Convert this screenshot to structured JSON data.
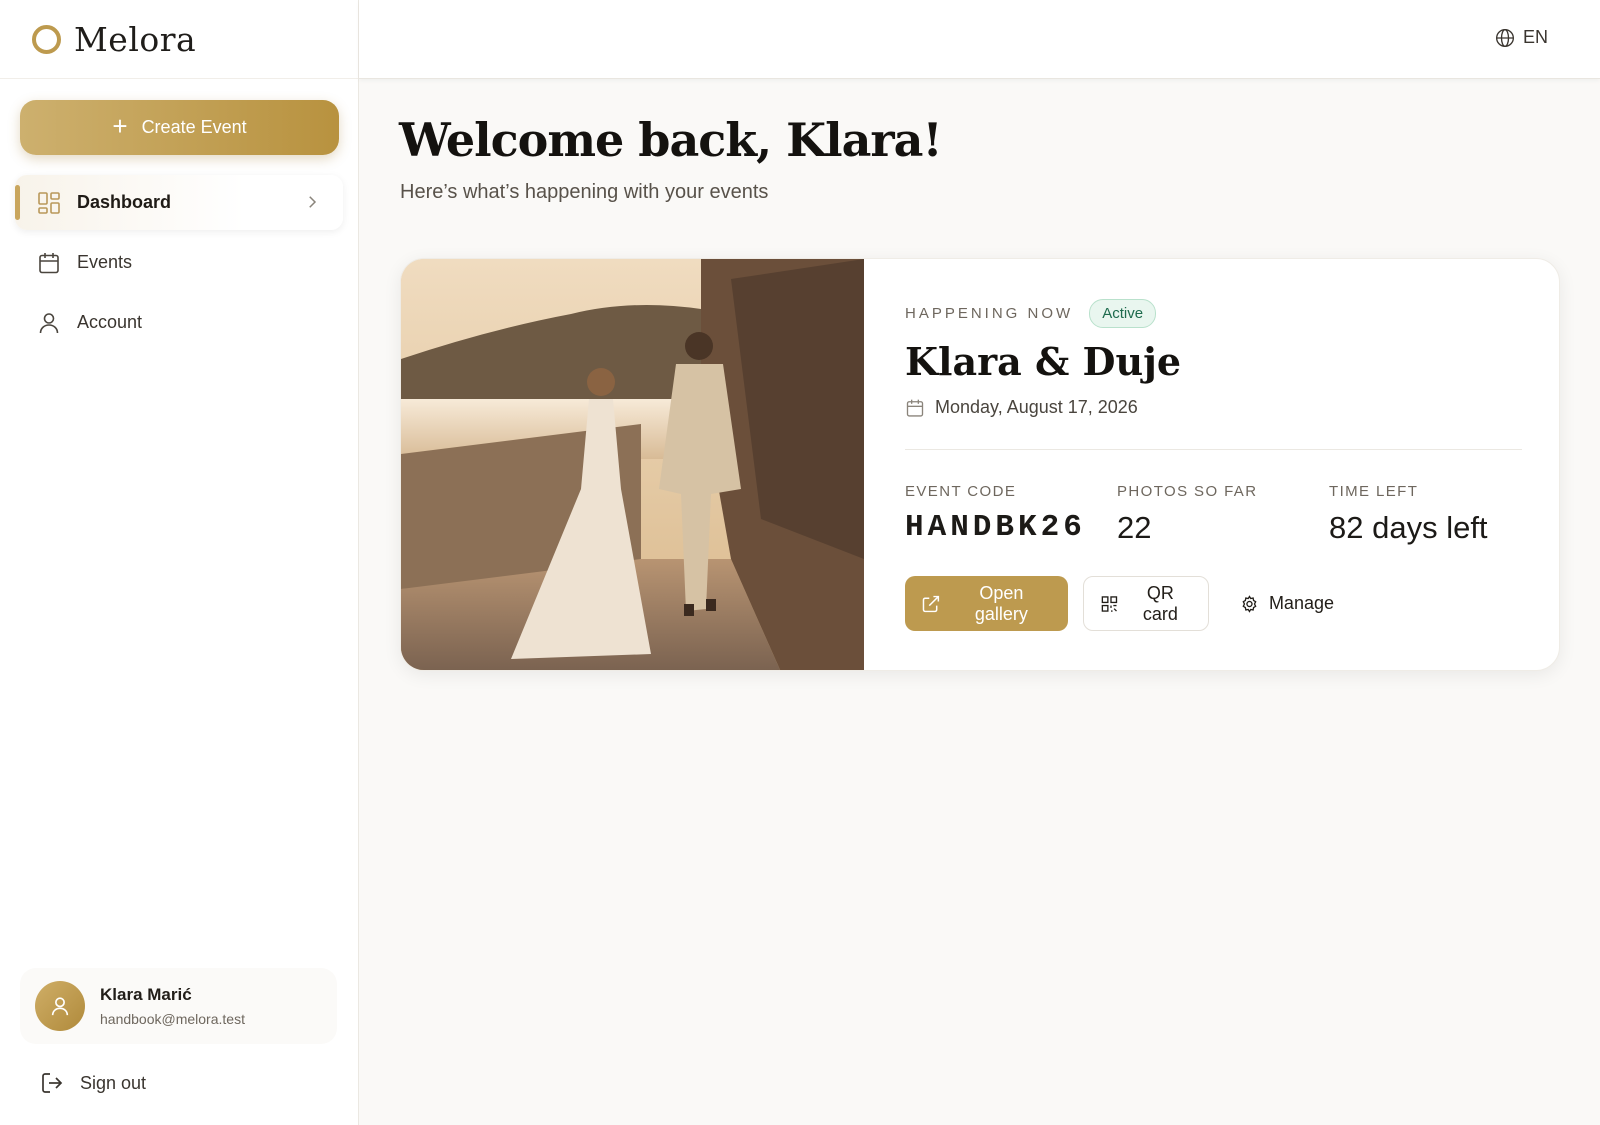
{
  "brand": {
    "name": "Melora",
    "accent": "#bd9a4e"
  },
  "sidebar": {
    "create_label": "Create Event",
    "items": [
      {
        "label": "Dashboard",
        "icon": "dashboard-grid-icon",
        "active": true
      },
      {
        "label": "Events",
        "icon": "calendar-icon",
        "active": false
      },
      {
        "label": "Account",
        "icon": "user-icon",
        "active": false
      }
    ],
    "user": {
      "name": "Klara Marić",
      "email": "handbook@melora.test"
    },
    "signout_label": "Sign out"
  },
  "topbar": {
    "language": "EN",
    "language_icon": "globe-icon"
  },
  "main": {
    "welcome": "Welcome back, Klara!",
    "subtitle": "Here’s what’s happening with your events",
    "event": {
      "kicker": "HAPPENING NOW",
      "status": "Active",
      "title": "Klara & Duje",
      "date": "Monday, August 17, 2026",
      "stats": [
        {
          "label": "EVENT CODE",
          "value": "HANDBK26"
        },
        {
          "label": "PHOTOS SO FAR",
          "value": "22"
        },
        {
          "label": "TIME LEFT",
          "value": "82 days left"
        }
      ],
      "actions": {
        "open_gallery": "Open gallery",
        "qr_card": "QR card",
        "manage": "Manage"
      }
    }
  },
  "colors": {
    "gold": "#bd9a4f",
    "active_badge_text": "#1e6b4d",
    "active_badge_bg": "#e9f6ef"
  }
}
